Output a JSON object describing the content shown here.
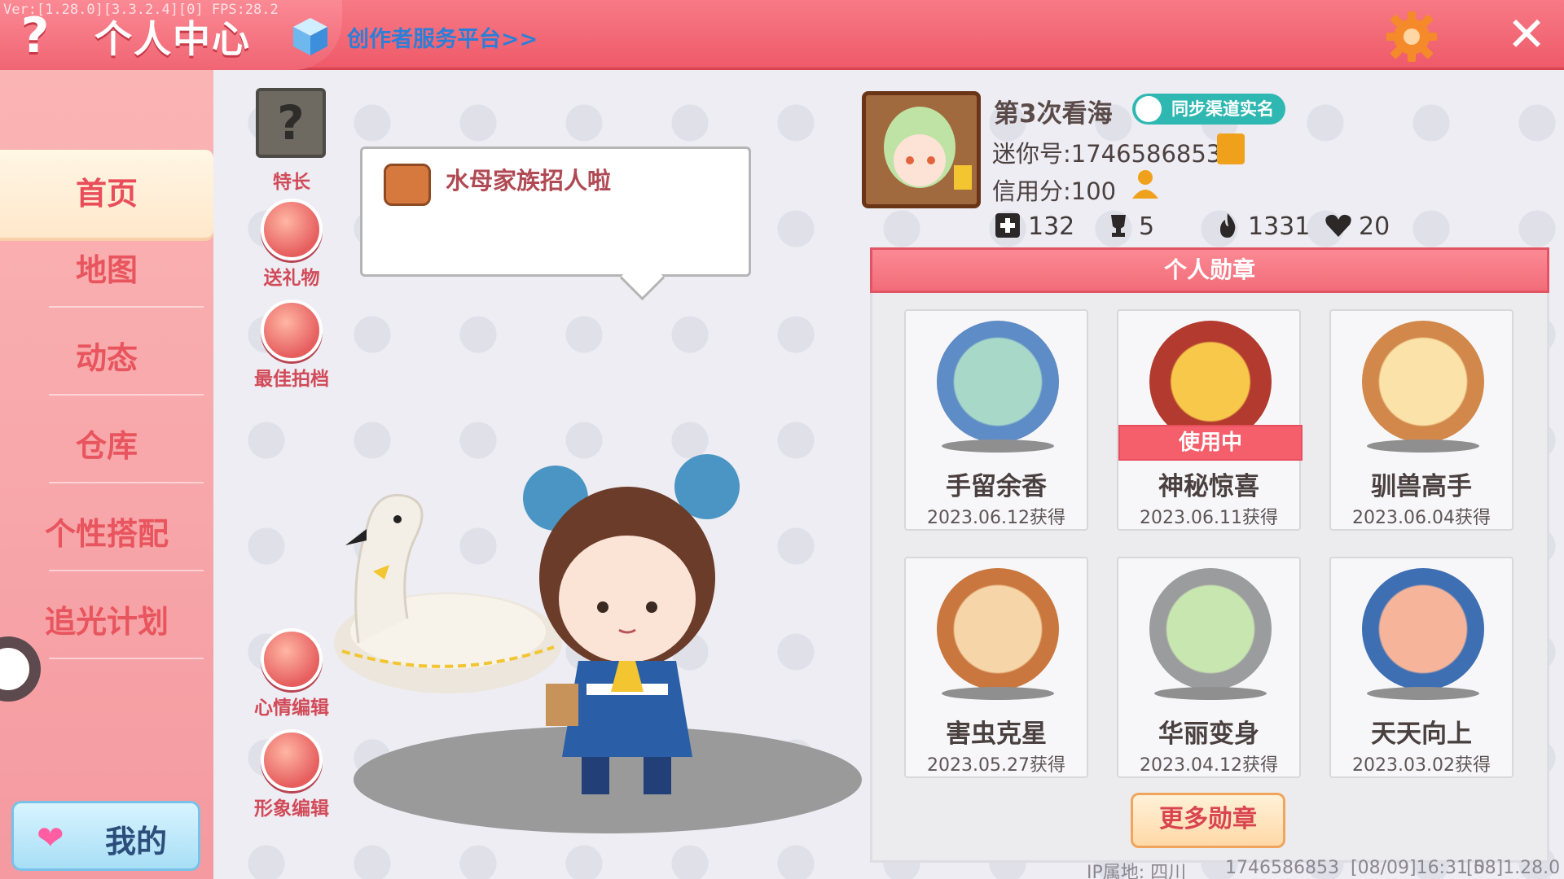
{
  "header": {
    "version_text": "Ver:[1.28.0][3.3.2.4][0] FPS:28.2",
    "title": "个人中心",
    "creator_link": "创作者服务平台>>",
    "help_glyph": "?",
    "close_glyph": "✕"
  },
  "sidebar": {
    "items": [
      {
        "label": "首页",
        "active": true
      },
      {
        "label": "地图",
        "active": false
      },
      {
        "label": "动态",
        "active": false
      },
      {
        "label": "仓库",
        "active": false
      },
      {
        "label": "个性搭配",
        "active": false
      },
      {
        "label": "追光计划",
        "active": false
      }
    ],
    "mine_label": "我的"
  },
  "actions": {
    "specialty": "特长",
    "gift": "送礼物",
    "partner": "最佳拍档",
    "mood_edit": "心情编辑",
    "image_edit": "形象编辑",
    "specialty_glyph": "?"
  },
  "speech": {
    "text": "水母家族招人啦"
  },
  "profile": {
    "name": "第3次看海",
    "verify_label": "同步渠道实名",
    "mini_id": "迷你号:1746586853",
    "credit": "信用分:100"
  },
  "stats": [
    {
      "icon": "plus-icon",
      "value": "132"
    },
    {
      "icon": "trophy-icon",
      "value": "5"
    },
    {
      "icon": "flame-icon",
      "value": "1331"
    },
    {
      "icon": "heart-icon",
      "value": "20"
    }
  ],
  "badges": {
    "header": "个人勋章",
    "in_use_label": "使用中",
    "items": [
      {
        "name": "手留余香",
        "date": "2023.06.12获得",
        "color": "#5e8cc7",
        "in_use": false
      },
      {
        "name": "神秘惊喜",
        "date": "2023.06.11获得",
        "color": "#b23a2e",
        "in_use": true
      },
      {
        "name": "驯兽高手",
        "date": "2023.06.04获得",
        "color": "#d1884a",
        "in_use": false
      },
      {
        "name": "害虫克星",
        "date": "2023.05.27获得",
        "color": "#c9773f",
        "in_use": false
      },
      {
        "name": "华丽变身",
        "date": "2023.04.12获得",
        "color": "#9b9c9e",
        "in_use": false
      },
      {
        "name": "天天向上",
        "date": "2023.03.02获得",
        "color": "#3f6fb3",
        "in_use": false
      }
    ],
    "more_label": "更多勋章"
  },
  "footer": {
    "ip": "IP属地: 四川",
    "uid": "1746586853",
    "timestamp": "[08/09]16:31 0",
    "build": "[58]1.28.0"
  },
  "colors": {
    "accent": "#ef5a69",
    "sidebar": "#f49aa0",
    "link": "#2a7fd8",
    "verify": "#2fb8b2"
  }
}
